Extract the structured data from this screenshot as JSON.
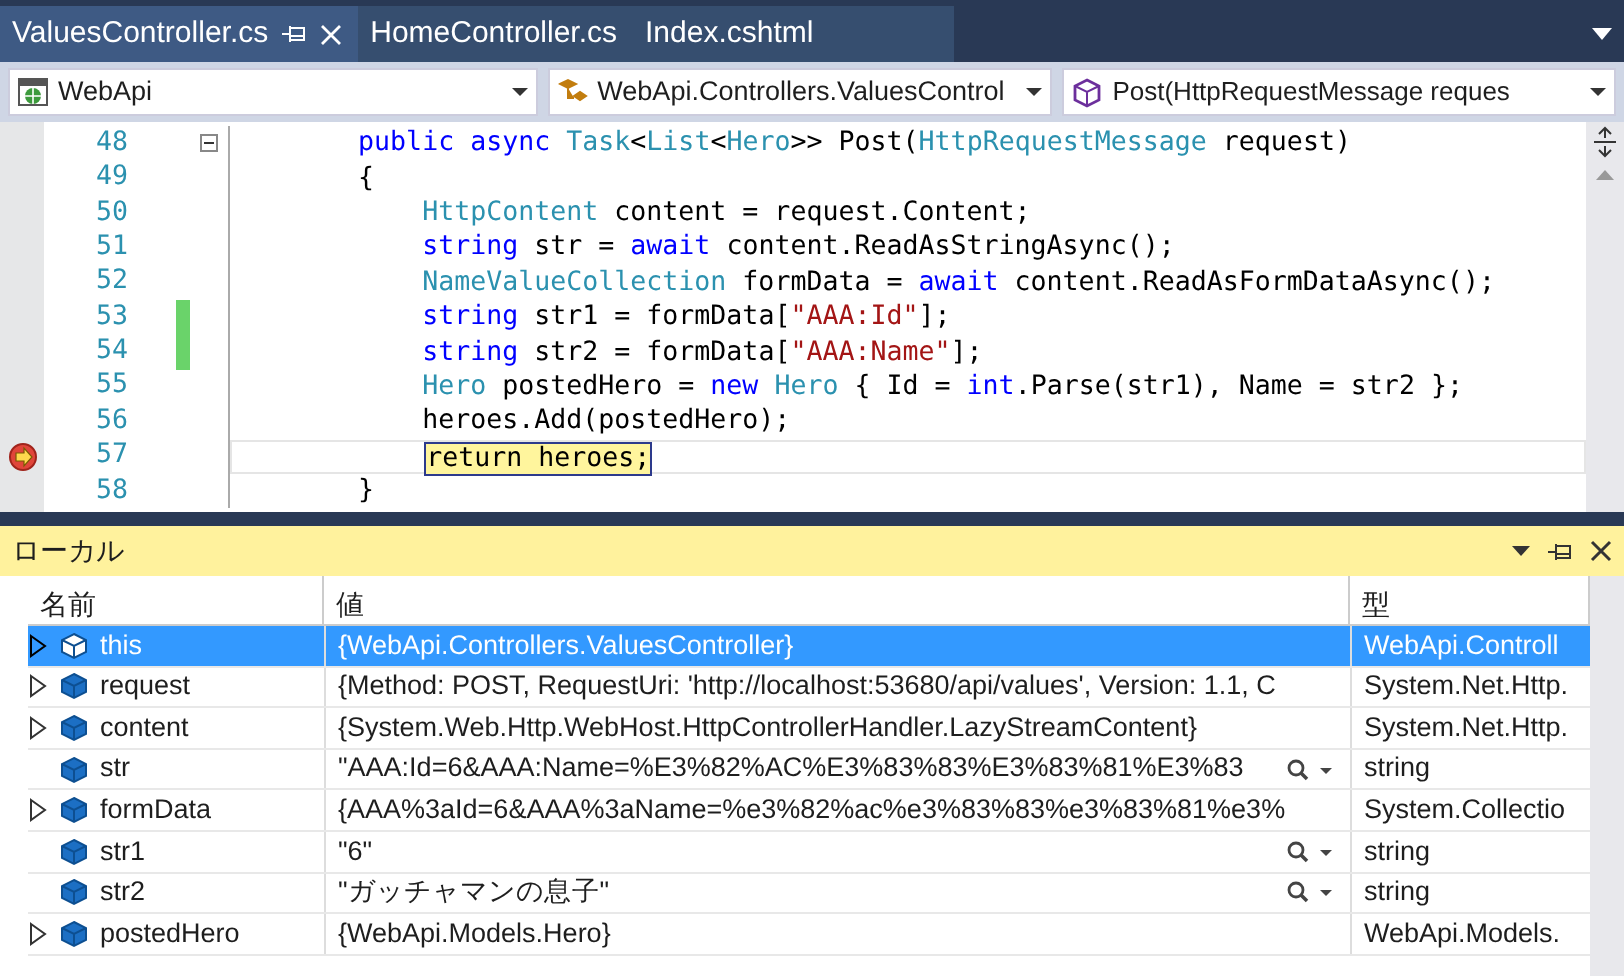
{
  "tabs": [
    {
      "label": "ValuesController.cs",
      "selected": true,
      "pinned": true,
      "closable": true
    },
    {
      "label": "HomeController.cs",
      "selected": false,
      "pinned": false,
      "closable": false
    },
    {
      "label": "Index.cshtml",
      "selected": false,
      "pinned": false,
      "closable": false
    }
  ],
  "navigation": [
    {
      "kind": "project",
      "text": "WebApi"
    },
    {
      "kind": "class",
      "text": "WebApi.Controllers.ValuesControl"
    },
    {
      "kind": "method",
      "text": "Post(HttpRequestMessage reques"
    }
  ],
  "code": {
    "lines": [
      {
        "number": "48",
        "collapsible": true,
        "changed": false,
        "current": false,
        "tokens": [
          {
            "kind": "kw",
            "text": "        public async "
          },
          {
            "kind": "type",
            "text": "Task"
          },
          {
            "kind": "plain",
            "text": "<"
          },
          {
            "kind": "type",
            "text": "List"
          },
          {
            "kind": "plain",
            "text": "<"
          },
          {
            "kind": "type",
            "text": "Hero"
          },
          {
            "kind": "plain",
            "text": ">> Post("
          },
          {
            "kind": "type",
            "text": "HttpRequestMessage"
          },
          {
            "kind": "plain",
            "text": " request)"
          }
        ]
      },
      {
        "number": "49",
        "collapsible": false,
        "changed": false,
        "current": false,
        "tokens": [
          {
            "kind": "plain",
            "text": "        {"
          }
        ]
      },
      {
        "number": "50",
        "collapsible": false,
        "changed": false,
        "current": false,
        "tokens": [
          {
            "kind": "type",
            "text": "            HttpContent"
          },
          {
            "kind": "plain",
            "text": " content = request.Content;"
          }
        ]
      },
      {
        "number": "51",
        "collapsible": false,
        "changed": false,
        "current": false,
        "tokens": [
          {
            "kind": "kw",
            "text": "            string"
          },
          {
            "kind": "plain",
            "text": " str = "
          },
          {
            "kind": "kw",
            "text": "await"
          },
          {
            "kind": "plain",
            "text": " content.ReadAsStringAsync();"
          }
        ]
      },
      {
        "number": "52",
        "collapsible": false,
        "changed": false,
        "current": false,
        "tokens": [
          {
            "kind": "type",
            "text": "            NameValueCollection"
          },
          {
            "kind": "plain",
            "text": " formData = "
          },
          {
            "kind": "kw",
            "text": "await"
          },
          {
            "kind": "plain",
            "text": " content.ReadAsFormDataAsync();"
          }
        ]
      },
      {
        "number": "53",
        "collapsible": false,
        "changed": true,
        "current": false,
        "tokens": [
          {
            "kind": "kw",
            "text": "            string"
          },
          {
            "kind": "plain",
            "text": " str1 = formData["
          },
          {
            "kind": "str",
            "text": "\"AAA:Id\""
          },
          {
            "kind": "plain",
            "text": "];"
          }
        ]
      },
      {
        "number": "54",
        "collapsible": false,
        "changed": true,
        "current": false,
        "tokens": [
          {
            "kind": "kw",
            "text": "            string"
          },
          {
            "kind": "plain",
            "text": " str2 = formData["
          },
          {
            "kind": "str",
            "text": "\"AAA:Name\""
          },
          {
            "kind": "plain",
            "text": "];"
          }
        ]
      },
      {
        "number": "55",
        "collapsible": false,
        "changed": false,
        "current": false,
        "tokens": [
          {
            "kind": "type",
            "text": "            Hero"
          },
          {
            "kind": "plain",
            "text": " postedHero = "
          },
          {
            "kind": "kw",
            "text": "new "
          },
          {
            "kind": "type",
            "text": "Hero"
          },
          {
            "kind": "plain",
            "text": " { Id = "
          },
          {
            "kind": "kw",
            "text": "int"
          },
          {
            "kind": "plain",
            "text": ".Parse(str1), Name = str2 };"
          }
        ]
      },
      {
        "number": "56",
        "collapsible": false,
        "changed": false,
        "current": false,
        "tokens": [
          {
            "kind": "plain",
            "text": "            heroes.Add(postedHero);"
          }
        ]
      },
      {
        "number": "57",
        "collapsible": false,
        "changed": false,
        "current": true,
        "tokens": [
          {
            "kind": "hl",
            "text": "return heroes;"
          }
        ]
      },
      {
        "number": "58",
        "collapsible": false,
        "changed": false,
        "current": false,
        "tokens": [
          {
            "kind": "plain",
            "text": "        }"
          }
        ]
      }
    ]
  },
  "locals": {
    "title": "ローカル",
    "columns": [
      "名前",
      "値",
      "型"
    ],
    "rows": [
      {
        "name": "this",
        "value": "{WebApi.Controllers.ValuesController}",
        "type": "WebApi.Controll",
        "expandable": true,
        "selected": true,
        "visualizer": false
      },
      {
        "name": "request",
        "value": "{Method: POST, RequestUri: 'http://localhost:53680/api/values', Version: 1.1, C",
        "type": "System.Net.Http.",
        "expandable": true,
        "selected": false,
        "visualizer": false
      },
      {
        "name": "content",
        "value": "{System.Web.Http.WebHost.HttpControllerHandler.LazyStreamContent}",
        "type": "System.Net.Http.",
        "expandable": true,
        "selected": false,
        "visualizer": false
      },
      {
        "name": "str",
        "value": "\"AAA:Id=6&AAA:Name=%E3%82%AC%E3%83%83%E3%83%81%E3%83",
        "type": "string",
        "expandable": false,
        "selected": false,
        "visualizer": true
      },
      {
        "name": "formData",
        "value": "{AAA%3aId=6&AAA%3aName=%e3%82%ac%e3%83%83%e3%83%81%e3%",
        "type": "System.Collectio",
        "expandable": true,
        "selected": false,
        "visualizer": false
      },
      {
        "name": "str1",
        "value": "\"6\"",
        "type": "string",
        "expandable": false,
        "selected": false,
        "visualizer": true
      },
      {
        "name": "str2",
        "value": "\"ガッチャマンの息子\"",
        "type": "string",
        "expandable": false,
        "selected": false,
        "visualizer": true
      },
      {
        "name": "postedHero",
        "value": "{WebApi.Models.Hero}",
        "type": "WebApi.Models.",
        "expandable": true,
        "selected": false,
        "visualizer": false
      }
    ]
  }
}
